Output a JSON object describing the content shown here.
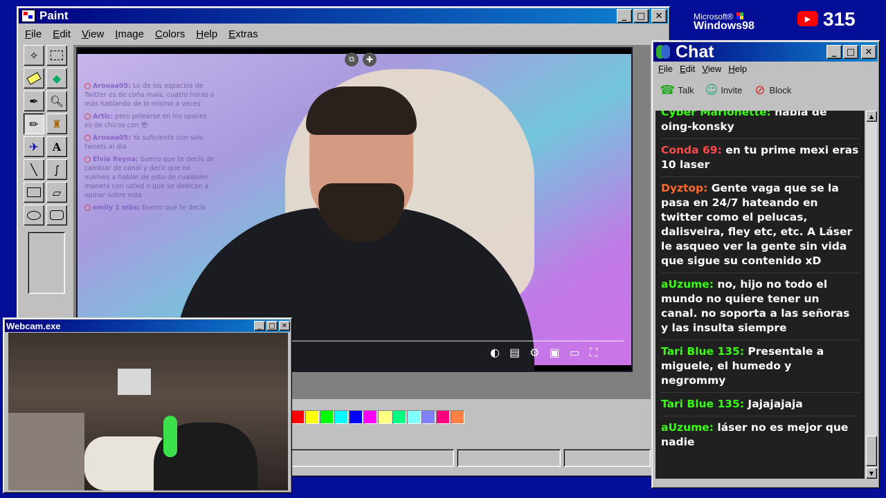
{
  "paint": {
    "title": "Paint",
    "menu": [
      "File",
      "Edit",
      "View",
      "Image",
      "Colors",
      "Help",
      "Extras"
    ],
    "tools": [
      "free-select-icon",
      "rect-select-icon",
      "eraser-icon",
      "fill-icon",
      "eyedropper-icon",
      "magnifier-icon",
      "pencil-icon",
      "brush-icon",
      "airbrush-icon",
      "text-icon",
      "line-icon",
      "curve-icon",
      "rectangle-icon",
      "polygon-icon",
      "ellipse-icon",
      "rounded-rect-icon"
    ],
    "palette": [
      "#ff0000",
      "#ffff00",
      "#00ff00",
      "#00ffff",
      "#0000ff",
      "#ff00ff",
      "#ffff80",
      "#00ff80",
      "#80ffff",
      "#8080ff",
      "#ff0080",
      "#ff8040"
    ]
  },
  "video_overlay_chat": [
    {
      "user": "Arooaa05:",
      "text": "Lo de los espacios de Twitter es de coña mala, cuatro horas o más hablando de lo mismo a veces"
    },
    {
      "user": "Artic:",
      "text": "pero pelearse en los spaces es de chicos con 😎"
    },
    {
      "user": "Arooaa05:",
      "text": "Ya suficiente con solo tweets al día"
    },
    {
      "user": "Elvia Reyna:",
      "text": "bueno que te decía de cambiar de canal y decir que no vuelves a hablar de esto de cualquier manera con usted o que se dedican a opinar sobre esta"
    },
    {
      "user": "emily 1 mbs:",
      "text": "bueno que te decía"
    }
  ],
  "webcam": {
    "title": "Webcam.exe"
  },
  "brand": {
    "microsoft": "Microsoft®",
    "windows": "Windows98",
    "views": "315"
  },
  "chat": {
    "title": "Chat",
    "menu": [
      "File",
      "Edit",
      "View",
      "Help"
    ],
    "toolbar": {
      "talk": "Talk",
      "invite": "Invite",
      "block": "Block"
    },
    "messages": [
      {
        "user": "Cyber Marionette:",
        "color": "#39ff14",
        "text": "habla de oing-konsky"
      },
      {
        "user": "Conda 69:",
        "color": "#ff4a4a",
        "text": "en tu prime mexi eras 10 laser"
      },
      {
        "user": "Dyztop:",
        "color": "#ff6a2a",
        "text": "Gente vaga que se la pasa en 24/7 hateando en twitter como el pelucas, dalisveira, fley etc, etc. A Láser le asqueo ver la gente sin vida que sigue su contenido xD"
      },
      {
        "user": "aUzume:",
        "color": "#39ff14",
        "text": "no, hijo no todo el mundo no quiere tener un canal. no soporta a las señoras y las insulta siempre"
      },
      {
        "user": "Tari Blue 135:",
        "color": "#39ff14",
        "text": "Presentale a miguele, el humedo y negrommy"
      },
      {
        "user": "Tari Blue 135:",
        "color": "#39ff14",
        "text": "Jajajajaja"
      },
      {
        "user": "aUzume:",
        "color": "#39ff14",
        "text": "láser no es mejor que nadie"
      }
    ]
  }
}
